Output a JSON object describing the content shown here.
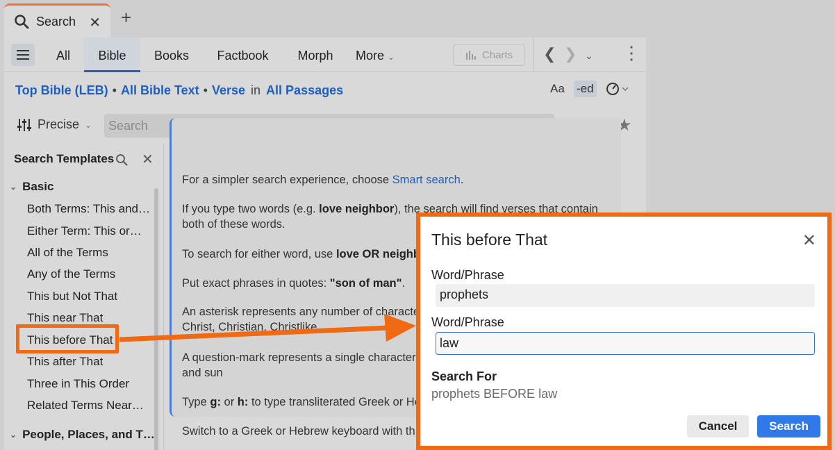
{
  "tab": {
    "label": "Search",
    "close": "✕",
    "new": "+"
  },
  "toolbar": {
    "tabs": [
      "All",
      "Bible",
      "Books",
      "Factbook",
      "Morph"
    ],
    "more": "More",
    "charts": "Charts"
  },
  "scope": {
    "bible": "Top Bible (LEB)",
    "text": "All Bible Text",
    "unit": "Verse",
    "in": "in",
    "passages": "All Passages"
  },
  "view_icons": {
    "font": "Aa",
    "ed": "-ed"
  },
  "search": {
    "mode": "Precise",
    "placeholder": "Search"
  },
  "templates": {
    "title": "Search Templates",
    "groups": [
      "Basic",
      "People, Places, and T…"
    ],
    "items": [
      "Both Terms: This and…",
      "Either Term: This or…",
      "All of the Terms",
      "Any of the Terms",
      "This but Not That",
      "This near That",
      "This before That",
      "This after That",
      "Three in This Order",
      "Related Terms Near…"
    ]
  },
  "help": [
    {
      "pre": "For a simpler search experience, choose ",
      "link": "Smart search",
      "post": "."
    },
    {
      "l1a": "If you type two words (e.g. ",
      "l1b": "love neighbor",
      "l1c": "), the search will find verses that contain",
      "l2": "both of these words."
    },
    {
      "pre": "To search for either word, use ",
      "bold": "love OR neighb"
    },
    {
      "pre": "Put exact phrases in quotes: ",
      "bold": "\"son of man\"",
      "post": "."
    },
    {
      "l1": "An asterisk represents any number of characte",
      "l2": "Christ, Christian, Christlike."
    },
    {
      "l1": "A question-mark represents a single character",
      "l2": "and sun"
    },
    {
      "pre": "Type ",
      "b1": "g:",
      "mid": " or ",
      "b2": "h:",
      "post": " to type transliterated Greek or He"
    },
    {
      "text": "Switch to a Greek or Hebrew keyboard with th"
    }
  ],
  "dialog": {
    "title": "This before That",
    "field1_label": "Word/Phrase",
    "field1_value": "prophets",
    "field2_label": "Word/Phrase",
    "field2_value": "law",
    "search_for_label": "Search For",
    "search_for_value": "prophets BEFORE law",
    "cancel": "Cancel",
    "search": "Search"
  },
  "colors": {
    "accent": "#f06a13",
    "link": "#1c5fbf",
    "primary_button": "#2f79e8"
  }
}
